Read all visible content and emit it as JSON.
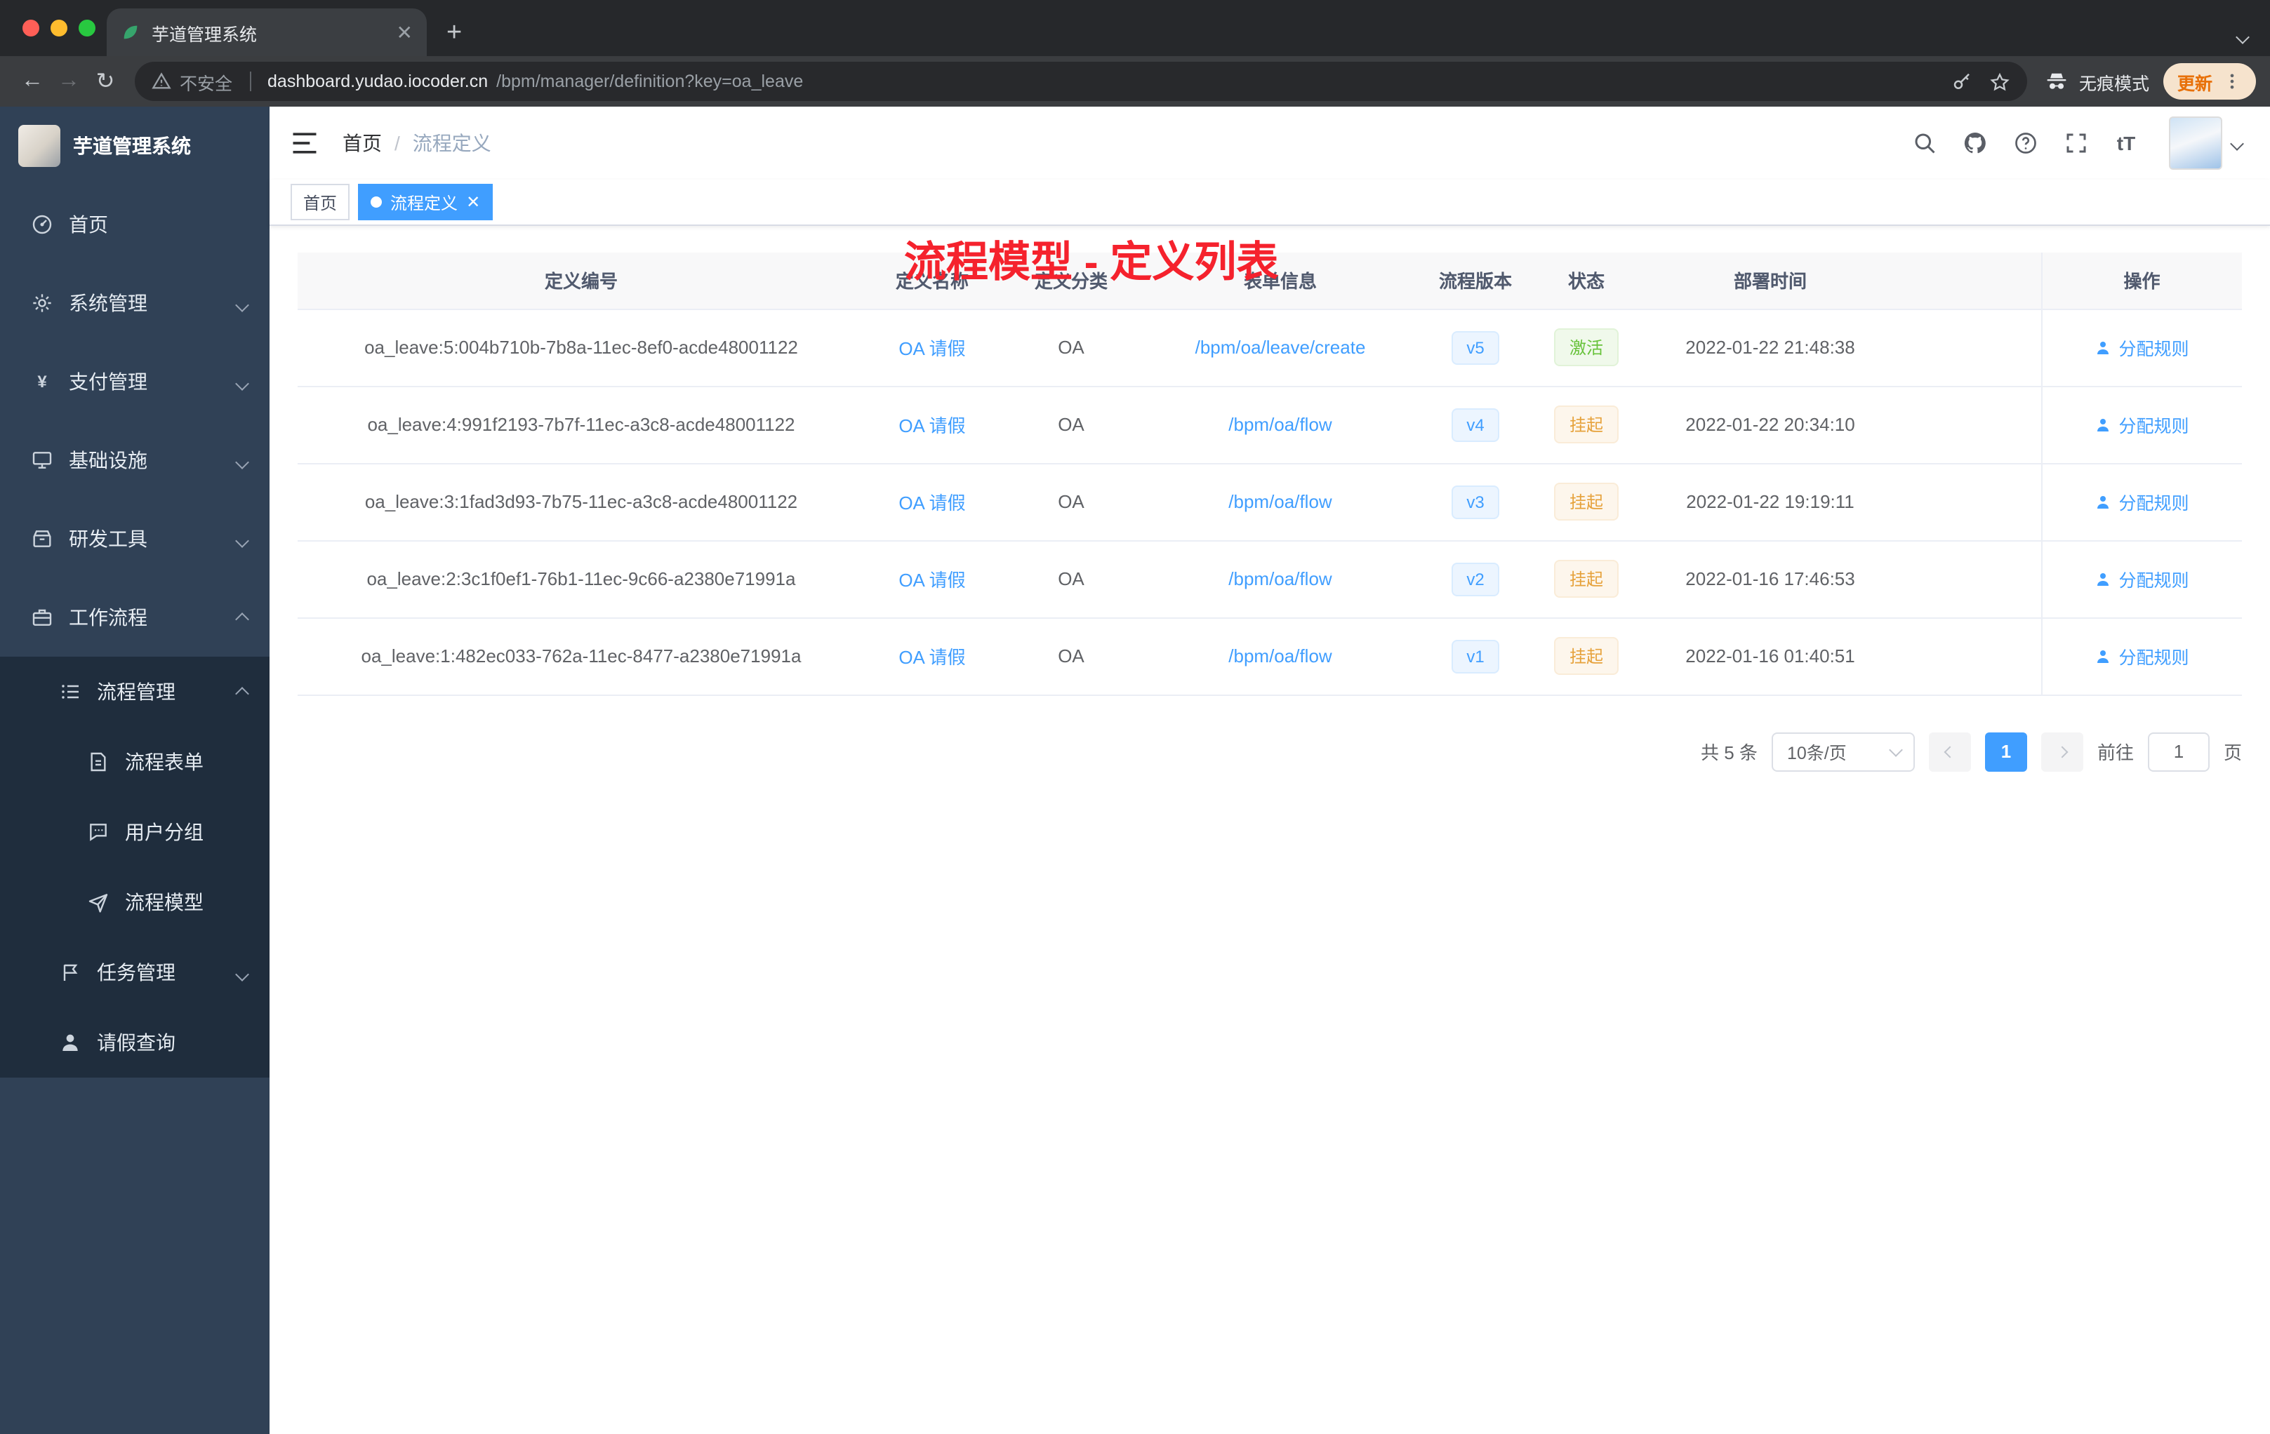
{
  "browser": {
    "tab_title": "芋道管理系统",
    "security_label": "不安全",
    "url_host": "dashboard.yudao.iocoder.cn",
    "url_path": "/bpm/manager/definition?key=oa_leave",
    "incognito_label": "无痕模式",
    "update_label": "更新"
  },
  "sidebar": {
    "logo_title": "芋道管理系统",
    "items": [
      {
        "label": "首页"
      },
      {
        "label": "系统管理"
      },
      {
        "label": "支付管理"
      },
      {
        "label": "基础设施"
      },
      {
        "label": "研发工具"
      },
      {
        "label": "工作流程"
      },
      {
        "label": "流程管理"
      },
      {
        "label": "流程表单"
      },
      {
        "label": "用户分组"
      },
      {
        "label": "流程模型"
      },
      {
        "label": "任务管理"
      },
      {
        "label": "请假查询"
      }
    ]
  },
  "header": {
    "breadcrumb_home": "首页",
    "breadcrumb_current": "流程定义",
    "annotation": "流程模型 - 定义列表"
  },
  "tags": {
    "home": "首页",
    "active": "流程定义"
  },
  "table": {
    "columns": [
      "定义编号",
      "定义名称",
      "定义分类",
      "表单信息",
      "流程版本",
      "状态",
      "部署时间",
      "操作"
    ],
    "rows": [
      {
        "id": "oa_leave:5:004b710b-7b8a-11ec-8ef0-acde48001122",
        "name": "OA 请假",
        "category": "OA",
        "form": "/bpm/oa/leave/create",
        "version": "v5",
        "status": "激活",
        "status_type": "success",
        "deploy_time": "2022-01-22 21:48:38",
        "action": "分配规则"
      },
      {
        "id": "oa_leave:4:991f2193-7b7f-11ec-a3c8-acde48001122",
        "name": "OA 请假",
        "category": "OA",
        "form": "/bpm/oa/flow",
        "version": "v4",
        "status": "挂起",
        "status_type": "warning",
        "deploy_time": "2022-01-22 20:34:10",
        "action": "分配规则"
      },
      {
        "id": "oa_leave:3:1fad3d93-7b75-11ec-a3c8-acde48001122",
        "name": "OA 请假",
        "category": "OA",
        "form": "/bpm/oa/flow",
        "version": "v3",
        "status": "挂起",
        "status_type": "warning",
        "deploy_time": "2022-01-22 19:19:11",
        "action": "分配规则"
      },
      {
        "id": "oa_leave:2:3c1f0ef1-76b1-11ec-9c66-a2380e71991a",
        "name": "OA 请假",
        "category": "OA",
        "form": "/bpm/oa/flow",
        "version": "v2",
        "status": "挂起",
        "status_type": "warning",
        "deploy_time": "2022-01-16 17:46:53",
        "action": "分配规则"
      },
      {
        "id": "oa_leave:1:482ec033-762a-11ec-8477-a2380e71991a",
        "name": "OA 请假",
        "category": "OA",
        "form": "/bpm/oa/flow",
        "version": "v1",
        "status": "挂起",
        "status_type": "warning",
        "deploy_time": "2022-01-16 01:40:51",
        "action": "分配规则"
      }
    ]
  },
  "pagination": {
    "total": "共 5 条",
    "page_size": "10条/页",
    "page": "1",
    "goto_label": "前往",
    "goto_value": "1",
    "unit": "页"
  },
  "colors": {
    "accent": "#409eff",
    "success": "#67c23a",
    "warning": "#e6a23c",
    "annotation_red": "#f5222d",
    "sidebar_bg": "#304156",
    "submenu_bg": "#1f2d3d"
  }
}
